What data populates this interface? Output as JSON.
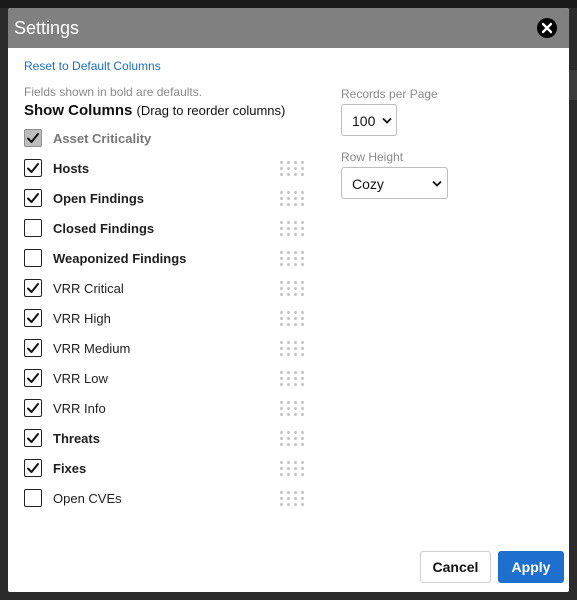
{
  "dialog": {
    "title": "Settings",
    "reset_label": "Reset to Default Columns",
    "hint": "Fields shown in bold are defaults.",
    "show_columns_title": "Show Columns",
    "show_columns_sub": "(Drag to reorder columns)"
  },
  "columns": [
    {
      "label": "Asset Criticality",
      "checked": true,
      "bold": true,
      "disabled": true
    },
    {
      "label": "Hosts",
      "checked": true,
      "bold": true,
      "disabled": false
    },
    {
      "label": "Open Findings",
      "checked": true,
      "bold": true,
      "disabled": false
    },
    {
      "label": "Closed Findings",
      "checked": false,
      "bold": true,
      "disabled": false
    },
    {
      "label": "Weaponized Findings",
      "checked": false,
      "bold": true,
      "disabled": false
    },
    {
      "label": "VRR Critical",
      "checked": true,
      "bold": false,
      "disabled": false
    },
    {
      "label": "VRR High",
      "checked": true,
      "bold": false,
      "disabled": false
    },
    {
      "label": "VRR Medium",
      "checked": true,
      "bold": false,
      "disabled": false
    },
    {
      "label": "VRR Low",
      "checked": true,
      "bold": false,
      "disabled": false
    },
    {
      "label": "VRR Info",
      "checked": true,
      "bold": false,
      "disabled": false
    },
    {
      "label": "Threats",
      "checked": true,
      "bold": true,
      "disabled": false
    },
    {
      "label": "Fixes",
      "checked": true,
      "bold": true,
      "disabled": false
    },
    {
      "label": "Open CVEs",
      "checked": false,
      "bold": false,
      "disabled": false
    }
  ],
  "records_per_page": {
    "label": "Records per Page",
    "value": "100"
  },
  "row_height": {
    "label": "Row Height",
    "value": "Cozy"
  },
  "buttons": {
    "cancel": "Cancel",
    "apply": "Apply"
  },
  "colors": {
    "accent": "#1f6fcf",
    "header": "#808080",
    "link": "#1f6fbf"
  }
}
